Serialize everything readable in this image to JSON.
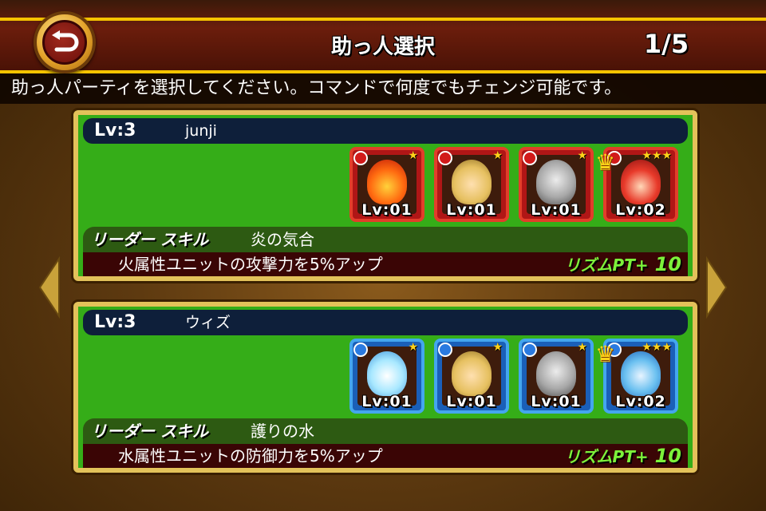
{
  "header": {
    "title": "助っ人選択",
    "page_count": "1/5",
    "instruction": "助っ人パーティを選択してください。コマンドで何度でもチェンジ可能です。"
  },
  "parties": [
    {
      "level": "Lv:3",
      "name": "junji",
      "element": "fire",
      "units": [
        {
          "level": "Lv:01",
          "stars": "★",
          "icon": "fire-spirit-icon"
        },
        {
          "level": "Lv:01",
          "stars": "★",
          "icon": "winged-warrior-icon"
        },
        {
          "level": "Lv:01",
          "stars": "★",
          "icon": "armored-knight-icon"
        },
        {
          "level": "Lv:02",
          "stars": "★★★",
          "icon": "red-hair-hero-icon",
          "leader": true
        }
      ],
      "skill_title": "リーダー スキル",
      "skill_name": "炎の気合",
      "skill_desc": "火属性ユニットの攻撃力を5%アップ",
      "rhythm_label": "リズムPT+",
      "rhythm_value": "10"
    },
    {
      "level": "Lv:3",
      "name": "ウィズ",
      "element": "water",
      "units": [
        {
          "level": "Lv:01",
          "stars": "★",
          "icon": "water-spirit-icon"
        },
        {
          "level": "Lv:01",
          "stars": "★",
          "icon": "winged-warrior-icon"
        },
        {
          "level": "Lv:01",
          "stars": "★",
          "icon": "armored-knight-icon"
        },
        {
          "level": "Lv:02",
          "stars": "★★★",
          "icon": "blue-hair-mage-icon",
          "leader": true
        }
      ],
      "skill_title": "リーダー スキル",
      "skill_name": "護りの水",
      "skill_desc": "水属性ユニットの防御力を5%アップ",
      "rhythm_label": "リズムPT+",
      "rhythm_value": "10"
    }
  ],
  "colors": {
    "frame_gold": "#f6c400",
    "card_green": "#35ad18",
    "fire_red": "#e23e2a",
    "water_blue": "#44a6ee",
    "rhythm_green": "#7cf23a"
  }
}
